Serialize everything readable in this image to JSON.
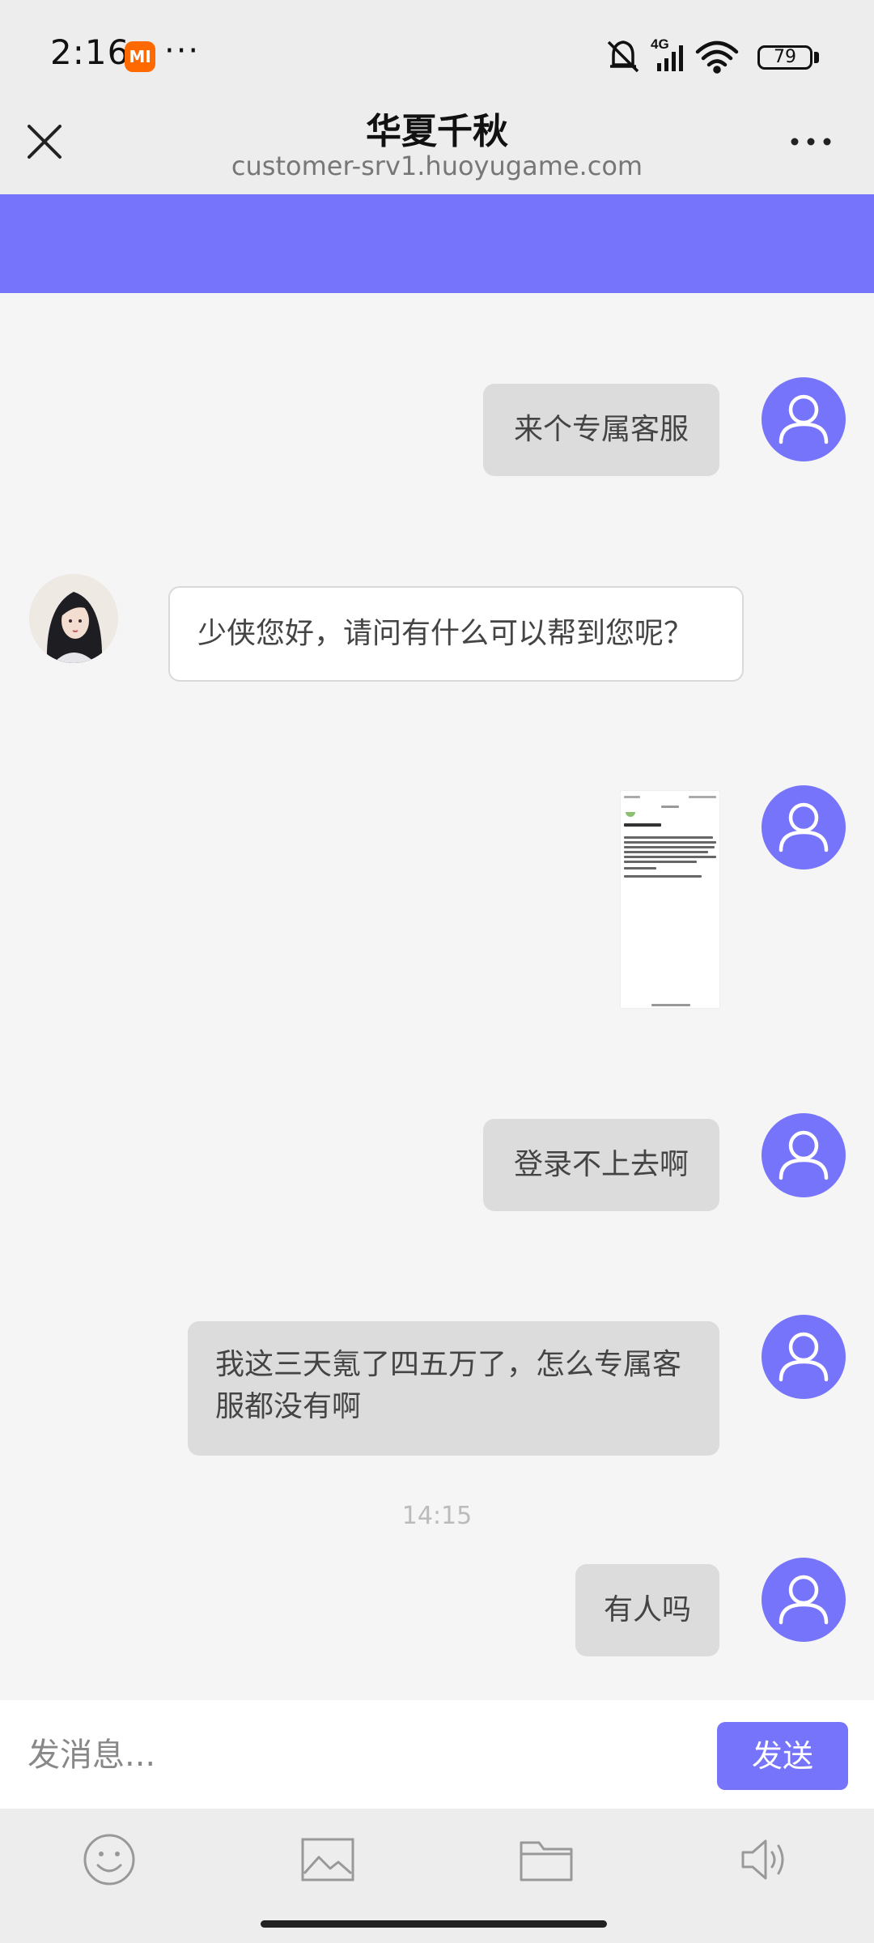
{
  "status_bar": {
    "time": "2:16",
    "brand_badge": "MI",
    "battery": "79",
    "icons": [
      "silent-icon",
      "signal-4g-icon",
      "wifi-icon",
      "battery-icon"
    ]
  },
  "header": {
    "title": "华夏千秋",
    "url": "customer-srv1.huoyugame.com"
  },
  "colors": {
    "accent": "#7774fc",
    "user_bubble": "#dcdcdc",
    "agent_bubble": "#ffffff"
  },
  "messages": [
    {
      "sender": "user",
      "type": "text",
      "text": "来个专属客服"
    },
    {
      "sender": "agent",
      "type": "text",
      "text": "少侠您好，请问有什么可以帮到您呢？"
    },
    {
      "sender": "user",
      "type": "image"
    },
    {
      "sender": "user",
      "type": "text",
      "text": "登录不上去啊"
    },
    {
      "sender": "user",
      "type": "text",
      "text": "我这三天氪了四五万了，怎么专属客服都没有啊"
    },
    {
      "sender": "user",
      "type": "text",
      "text": "有人吗"
    }
  ],
  "timestamp": "14:15",
  "input": {
    "placeholder": "发消息...",
    "send_label": "发送"
  },
  "toolbar": [
    "emoji-icon",
    "image-icon",
    "folder-icon",
    "voice-icon"
  ]
}
